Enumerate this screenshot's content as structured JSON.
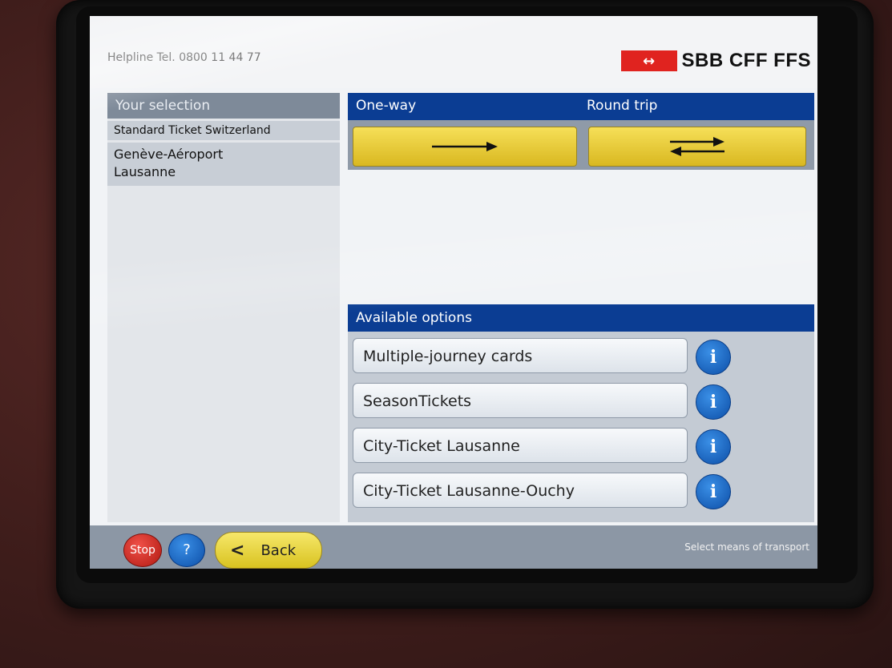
{
  "header": {
    "helpline": "Helpline Tel. 0800 11 44 77",
    "logo_mark": "↔",
    "logo_text": "SBB CFF FFS"
  },
  "selection": {
    "title": "Your selection",
    "ticket_type": "Standard Ticket Switzerland",
    "from": "Genève-Aéroport",
    "to": "Lausanne"
  },
  "trip": {
    "one_way_label": "One-way",
    "round_trip_label": "Round trip",
    "one_way_icon": "arrow-right-icon",
    "round_trip_icon": "arrows-both-ways-icon"
  },
  "options": {
    "title": "Available options",
    "info_symbol": "i",
    "items": [
      "Multiple-journey cards",
      "SeasonTickets",
      "City-Ticket Lausanne",
      "City-Ticket Lausanne-Ouchy"
    ]
  },
  "footer": {
    "stop_label": "Stop",
    "help_label": "?",
    "back_label": "Back",
    "back_icon": "chevron-left-icon",
    "status": "Select means of transport"
  },
  "colors": {
    "brand_red": "#e0231f",
    "header_blue": "#0b3d93",
    "button_yellow": "#f0d340",
    "info_blue": "#0d4fa8"
  }
}
